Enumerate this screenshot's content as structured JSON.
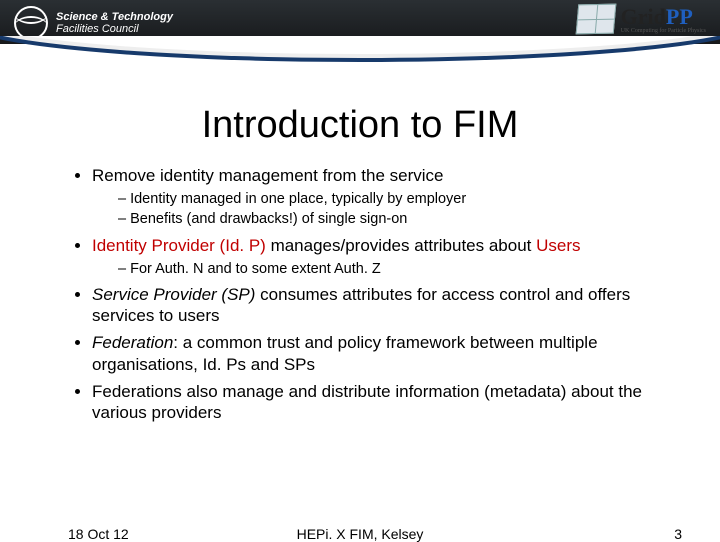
{
  "header": {
    "stfc_line1": "Science & Technology",
    "stfc_line2": "Facilities Council",
    "gridpp_name_a": "Grid",
    "gridpp_name_b": "PP",
    "gridpp_tagline": "UK Computing for Particle Physics"
  },
  "title": "Introduction to FIM",
  "bullets": {
    "b1": "Remove identity management from the service",
    "b1_subs": {
      "s1": "Identity managed in one place, typically by employer",
      "s2": "Benefits (and drawbacks!) of single sign-on"
    },
    "b2_a": "Identity Provider (Id. P)",
    "b2_b": " manages/provides attributes about ",
    "b2_c": "Users",
    "b2_subs": {
      "s1": "For Auth. N and to some extent Auth. Z"
    },
    "b3_a": "Service Provider (SP)",
    "b3_b": " consumes attributes for access control and offers services to users",
    "b4_a": "Federation",
    "b4_b": ": a common trust and policy framework between multiple organisations, Id. Ps and SPs",
    "b5": "Federations also manage and distribute information (metadata) about the various providers"
  },
  "footer": {
    "date": "18 Oct 12",
    "center": "HEPi. X FIM, Kelsey",
    "page": "3"
  }
}
